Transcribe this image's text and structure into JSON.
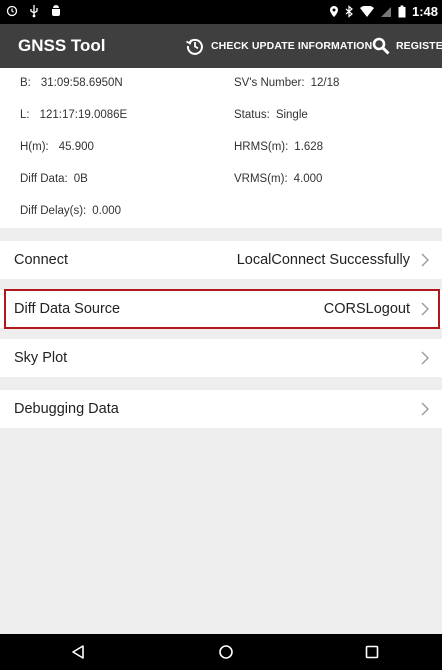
{
  "status_bar": {
    "time": "1:48",
    "left_icons": [
      "clock-icon",
      "usb-icon",
      "android-debug-icon"
    ],
    "right_icons": [
      "location-pin-icon",
      "bluetooth-icon",
      "wifi-icon",
      "signal-icon",
      "battery-icon"
    ]
  },
  "app_bar": {
    "title": "GNSS Tool",
    "check_update_label": "CHECK UPDATE INFORMATION",
    "register_label": "REGISTER"
  },
  "info": {
    "b_label": "B:",
    "b_value": "31:09:58.6950N",
    "l_label": "L:",
    "l_value": "121:17:19.0086E",
    "h_label": "H(m):",
    "h_value": "45.900",
    "diff_data_label": "Diff Data:",
    "diff_data_value": "0B",
    "diff_delay_label": "Diff Delay(s):",
    "diff_delay_value": "0.000",
    "sv_label": "SV's Number:",
    "sv_value": "12/18",
    "status_label": "Status:",
    "status_value": "Single",
    "hrms_label": "HRMS(m):",
    "hrms_value": "1.628",
    "vrms_label": "VRMS(m):",
    "vrms_value": "4.000"
  },
  "menu": {
    "connect_label": "Connect",
    "connect_value": "LocalConnect Successfully",
    "diff_source_label": "Diff Data Source",
    "diff_source_value": "CORSLogout",
    "sky_plot_label": "Sky Plot",
    "debugging_label": "Debugging Data"
  },
  "colors": {
    "app_bar": "#3f3f3f",
    "highlight": "#b0181b",
    "background": "#eeeeee"
  }
}
